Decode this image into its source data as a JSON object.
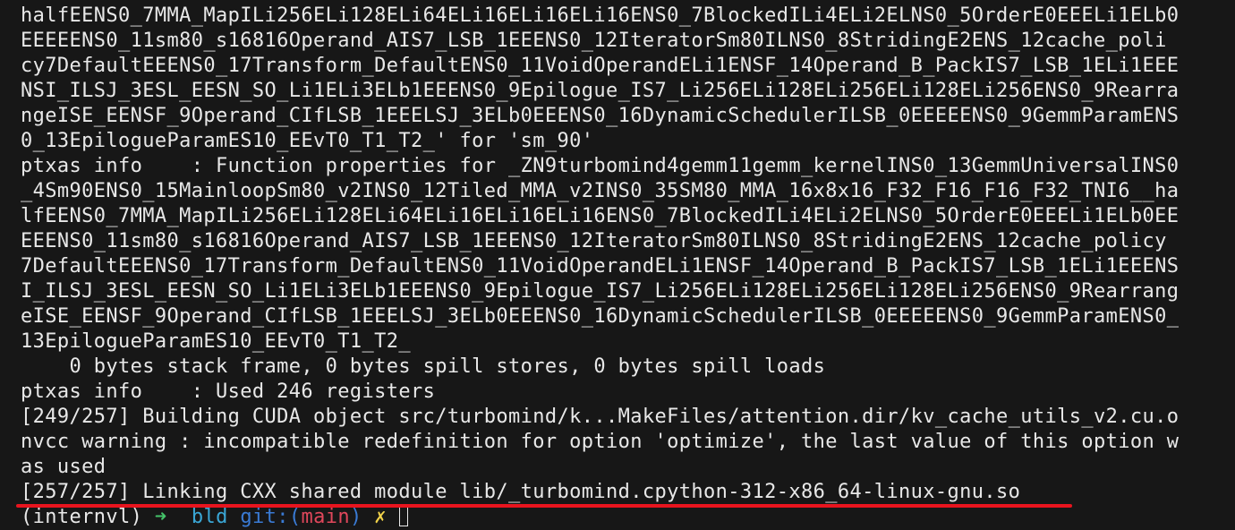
{
  "terminal": {
    "lines": [
      "halfEENS0_7MMA_MapILi256ELi128ELi64ELi16ELi16ELi16ENS0_7BlockedILi4ELi2ELNS0_5OrderE0EEELi1ELb0",
      "EEEEENS0_11sm80_s16816Operand_AIS7_LSB_1EEENS0_12IteratorSm80ILNS0_8StridingE2ENS_12cache_poli",
      "cy7DefaultEEENS0_17Transform_DefaultENS0_11VoidOperandELi1ENSF_14Operand_B_PackIS7_LSB_1ELi1EEE",
      "NSI_ILSJ_3ESL_EESN_SO_Li1ELi3ELb1EEENS0_9Epilogue_IS7_Li256ELi128ELi256ELi128ELi256ENS0_9Rearra",
      "ngeISE_EENSF_9Operand_CIfLSB_1EEELSJ_3ELb0EEENS0_16DynamicSchedulerILSB_0EEEEENS0_9GemmParamENS",
      "0_13EpilogueParamES10_EEvT0_T1_T2_' for 'sm_90'",
      "ptxas info    : Function properties for _ZN9turbomind4gemm11gemm_kernelINS0_13GemmUniversalINS0",
      "_4Sm90ENS0_15MainloopSm80_v2INS0_12Tiled_MMA_v2INS0_35SM80_MMA_16x8x16_F32_F16_F16_F32_TNI6__ha",
      "lfEENS0_7MMA_MapILi256ELi128ELi64ELi16ELi16ELi16ENS0_7BlockedILi4ELi2ELNS0_5OrderE0EEELi1ELb0EE",
      "EEENS0_11sm80_s16816Operand_AIS7_LSB_1EEENS0_12IteratorSm80ILNS0_8StridingE2ENS_12cache_policy",
      "7DefaultEEENS0_17Transform_DefaultENS0_11VoidOperandELi1ENSF_14Operand_B_PackIS7_LSB_1ELi1EEENS",
      "I_ILSJ_3ESL_EESN_SO_Li1ELi3ELb1EEENS0_9Epilogue_IS7_Li256ELi128ELi256ELi128ELi256ENS0_9Rearrang",
      "eISE_EENSF_9Operand_CIfLSB_1EEELSJ_3ELb0EEENS0_16DynamicSchedulerILSB_0EEEEENS0_9GemmParamENS0_",
      "13EpilogueParamES10_EEvT0_T1_T2_",
      "    0 bytes stack frame, 0 bytes spill stores, 0 bytes spill loads",
      "ptxas info    : Used 246 registers",
      "[249/257] Building CUDA object src/turbomind/k...MakeFiles/attention.dir/kv_cache_utils_v2.cu.o",
      "nvcc warning : incompatible redefinition for option 'optimize', the last value of this option w",
      "as used",
      "[257/257] Linking CXX shared module lib/_turbomind.cpython-312-x86_64-linux-gnu.so"
    ],
    "prompt": {
      "env": "(internvl)",
      "arrow": "➜",
      "dir": "bld",
      "git_label": "git:(",
      "branch": "main",
      "git_close": ")",
      "dirty": "✗"
    },
    "colors": {
      "background": "#171717",
      "text": "#e8e8e8",
      "highlight_underline": "#e8141e"
    }
  }
}
